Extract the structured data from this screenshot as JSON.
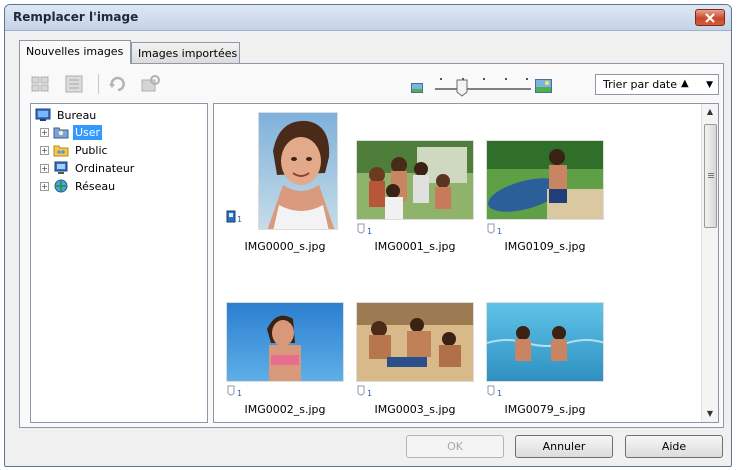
{
  "window": {
    "title": "Remplacer l'image"
  },
  "tabs": [
    {
      "label": "Nouvelles images",
      "active": true
    },
    {
      "label": "Images importées",
      "active": false
    }
  ],
  "toolbar": {
    "sort": {
      "selected": "Trier par date",
      "arrow": "▲"
    }
  },
  "tree": {
    "root": "Bureau",
    "items": [
      {
        "label": "User",
        "selected": true,
        "icon": "user-folder-icon"
      },
      {
        "label": "Public",
        "selected": false,
        "icon": "folder-icon"
      },
      {
        "label": "Ordinateur",
        "selected": false,
        "icon": "computer-icon"
      },
      {
        "label": "Réseau",
        "selected": false,
        "icon": "network-icon"
      }
    ]
  },
  "gallery": {
    "images": [
      {
        "filename": "IMG0000_s.jpg",
        "count": "1",
        "badge": "placed"
      },
      {
        "filename": "IMG0001_s.jpg",
        "count": "1",
        "badge": "normal"
      },
      {
        "filename": "IMG0109_s.jpg",
        "count": "1",
        "badge": "normal"
      },
      {
        "filename": "IMG0002_s.jpg",
        "count": "1",
        "badge": "normal"
      },
      {
        "filename": "IMG0003_s.jpg",
        "count": "1",
        "badge": "normal"
      },
      {
        "filename": "IMG0079_s.jpg",
        "count": "1",
        "badge": "normal"
      }
    ]
  },
  "buttons": {
    "ok": "OK",
    "cancel": "Annuler",
    "help": "Aide"
  },
  "colors": {
    "selection": "#3399ff",
    "close": "#c64a2e",
    "title_gradient_top": "#dfe8f3"
  }
}
